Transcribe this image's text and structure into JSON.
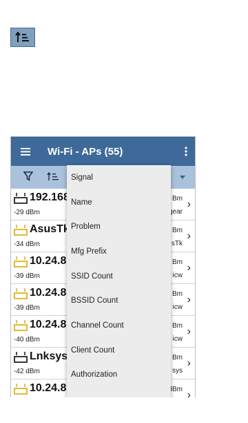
{
  "appbar": {
    "title": "Wi-Fi - APs (55)"
  },
  "icons": {
    "menu": "hamburger-icon",
    "more": "more-vertical-icon",
    "filter": "filter-icon",
    "sort": "sort-icon",
    "ap": "access-point-icon",
    "chevron": "chevron-right-icon"
  },
  "colors": {
    "appbar": "#3e6a99",
    "toolbar": "#a9c1db",
    "ap_yellow": "#e0b020",
    "ap_dark": "#222222"
  },
  "aps": [
    {
      "name": "192.168",
      "dbm": "-29 dBm",
      "r1": "Bm",
      "r2": "gear",
      "icon_color": "dark"
    },
    {
      "name": "AsusTk:",
      "dbm": "-34 dBm",
      "r1": "Bm",
      "r2": "sTk",
      "icon_color": "yellow"
    },
    {
      "name": "10.24.8.",
      "dbm": "-39 dBm",
      "r1": "Bm",
      "r2": "icw",
      "icon_color": "yellow"
    },
    {
      "name": "10.24.8.",
      "dbm": "-39 dBm",
      "r1": "Bm",
      "r2": "icw",
      "icon_color": "yellow"
    },
    {
      "name": "10.24.8.",
      "dbm": "-40 dBm",
      "r1": "Bm",
      "r2": "icw",
      "icon_color": "yellow"
    },
    {
      "name": "Lnksys:",
      "dbm": "-42 dBm",
      "r1": "Bm",
      "r2": "sys",
      "icon_color": "dark"
    },
    {
      "name": "10.24.8.35",
      "dbm": "",
      "r1": "-43 dBm",
      "r2": "",
      "icon_color": "yellow"
    }
  ],
  "sort_menu": {
    "options": [
      "Signal",
      "Name",
      "Problem",
      "Mfg Prefix",
      "SSID Count",
      "BSSID Count",
      "Channel Count",
      "Client Count",
      "Authorization"
    ]
  }
}
